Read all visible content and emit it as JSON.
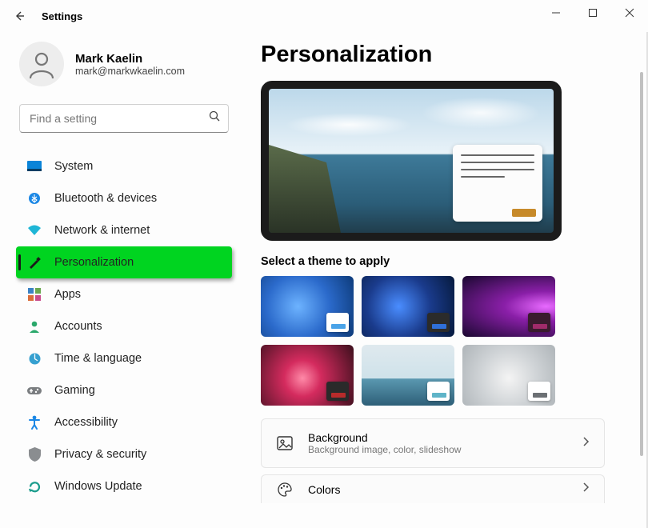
{
  "window": {
    "title": "Settings"
  },
  "user": {
    "name": "Mark Kaelin",
    "email": "mark@markwkaelin.com"
  },
  "search": {
    "placeholder": "Find a setting"
  },
  "nav": [
    {
      "id": "system",
      "label": "System"
    },
    {
      "id": "bluetooth",
      "label": "Bluetooth & devices"
    },
    {
      "id": "network",
      "label": "Network & internet"
    },
    {
      "id": "personalization",
      "label": "Personalization",
      "active": true
    },
    {
      "id": "apps",
      "label": "Apps"
    },
    {
      "id": "accounts",
      "label": "Accounts"
    },
    {
      "id": "time",
      "label": "Time & language"
    },
    {
      "id": "gaming",
      "label": "Gaming"
    },
    {
      "id": "accessibility",
      "label": "Accessibility"
    },
    {
      "id": "privacy",
      "label": "Privacy & security"
    },
    {
      "id": "update",
      "label": "Windows Update"
    }
  ],
  "page": {
    "title": "Personalization",
    "theme_section_label": "Select a theme to apply",
    "themes": {
      "chips": [
        "#4aa3e8",
        "#2f6fd8",
        "#a02b6a",
        "#b82b2b",
        "#5fb4c8",
        "#6c7074"
      ]
    },
    "rows": {
      "background": {
        "title": "Background",
        "subtitle": "Background image, color, slideshow"
      },
      "colors": {
        "title": "Colors"
      }
    }
  }
}
